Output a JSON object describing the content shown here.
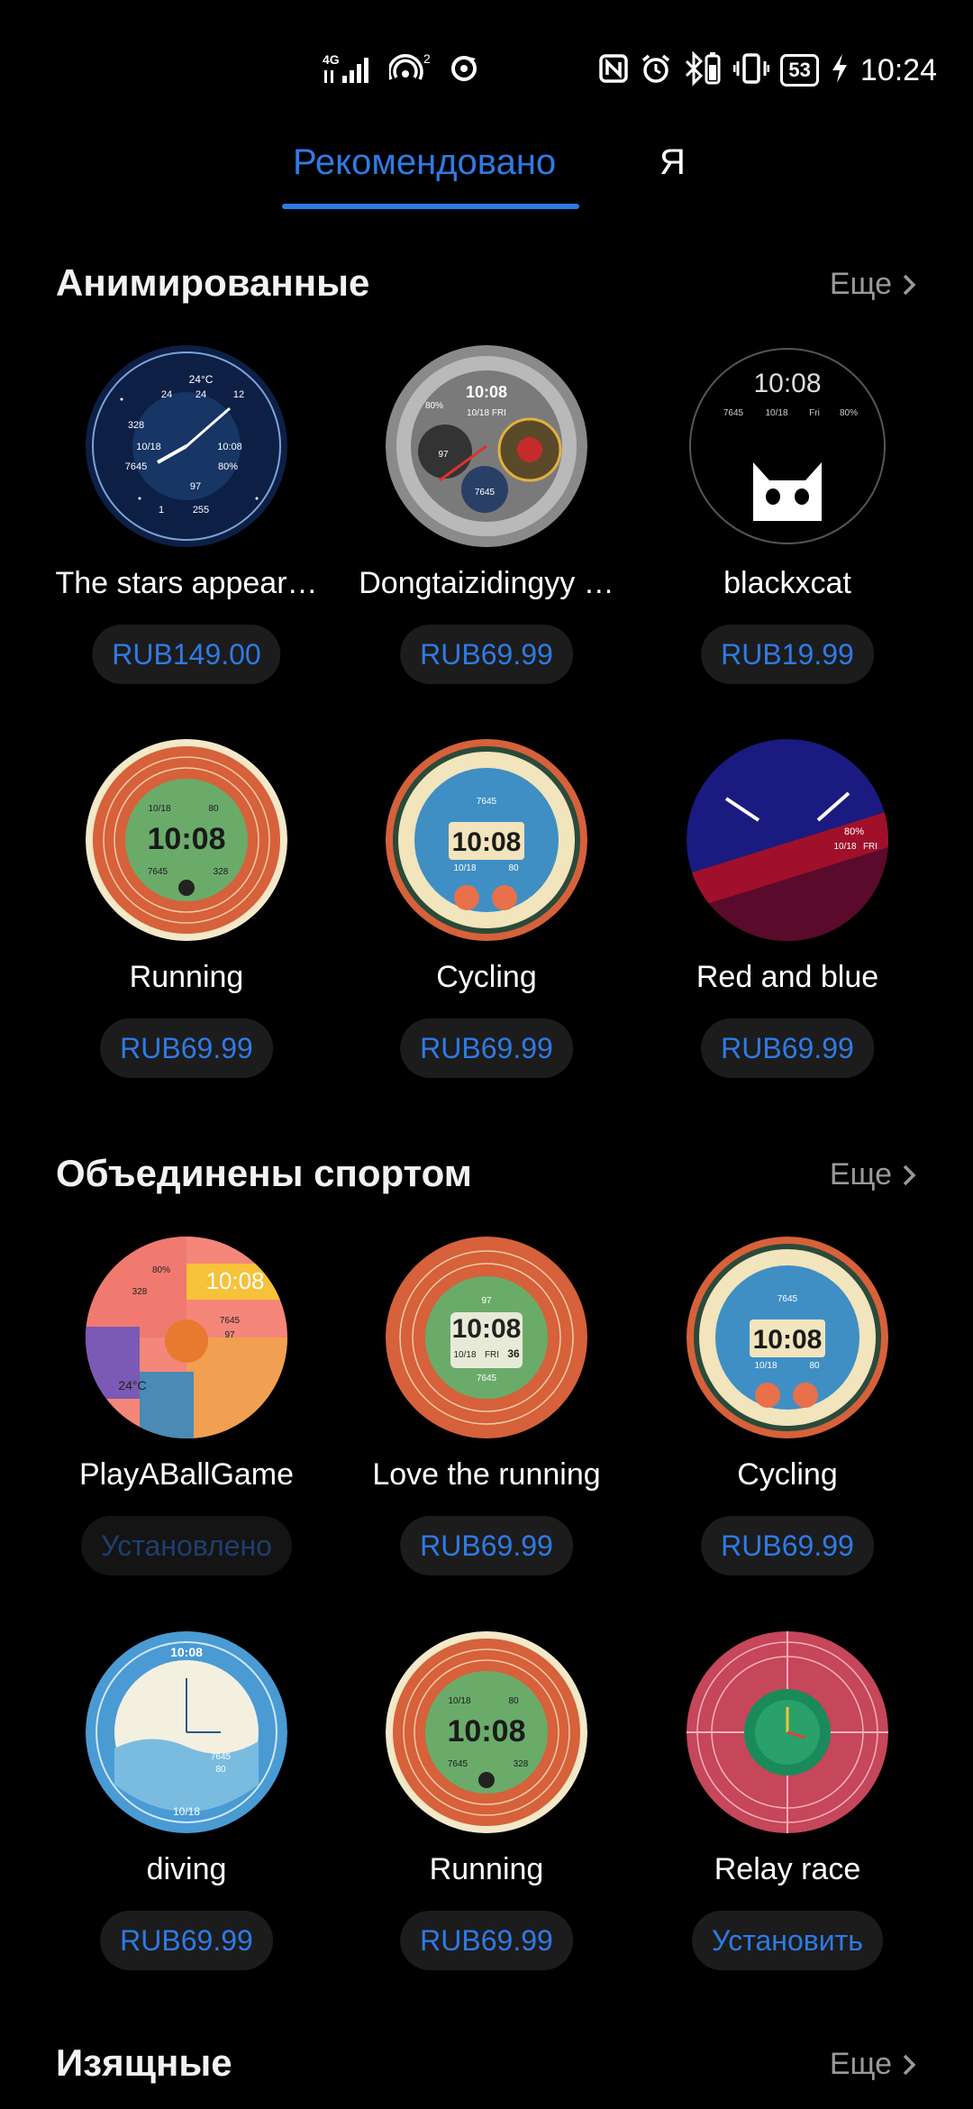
{
  "status_bar": {
    "network": "4G",
    "hotspot_count": "2",
    "battery": "53",
    "time": "10:24"
  },
  "tabs": [
    {
      "label": "Рекомендовано",
      "active": true
    },
    {
      "label": "Я",
      "active": false
    }
  ],
  "sections": [
    {
      "title": "Анимированные",
      "more": "Еще",
      "items": [
        {
          "name": "The stars appear…",
          "price": "RUB149.00",
          "face": {
            "type": "stars",
            "texts": [
              "24°C",
              "24",
              "24",
              "12",
              "328",
              "10/18",
              "10:08",
              "7645",
              "80%",
              "97",
              "1",
              "255"
            ]
          }
        },
        {
          "name": "Dongtaizidingyy …",
          "price": "RUB69.99",
          "face": {
            "type": "mech",
            "texts": [
              "10:08",
              "10/18 FRI",
              "80%",
              "97",
              "7645"
            ]
          }
        },
        {
          "name": "blackxcat",
          "price": "RUB19.99",
          "face": {
            "type": "cat",
            "texts": [
              "10:08",
              "7645",
              "10/18",
              "Fri",
              "80%"
            ]
          }
        },
        {
          "name": "Running",
          "price": "RUB69.99",
          "face": {
            "type": "run",
            "texts": [
              "10:08",
              "10/18",
              "80",
              "7645",
              "328"
            ]
          }
        },
        {
          "name": "Cycling",
          "price": "RUB69.99",
          "face": {
            "type": "cycle",
            "texts": [
              "10:08",
              "7645",
              "10/18",
              "80"
            ]
          }
        },
        {
          "name": "Red and blue",
          "price": "RUB69.99",
          "face": {
            "type": "redblue",
            "texts": [
              "80%",
              "10/18",
              "FRI"
            ]
          }
        }
      ]
    },
    {
      "title": "Объединены спортом",
      "more": "Еще",
      "items": [
        {
          "name": "PlayABallGame",
          "price": "Установлено",
          "installed": true,
          "face": {
            "type": "ball",
            "texts": [
              "10:08",
              "80%",
              "328",
              "7645",
              "97",
              "24°C"
            ]
          }
        },
        {
          "name": "Love the running",
          "price": "RUB69.99",
          "face": {
            "type": "love",
            "texts": [
              "10:08",
              "97",
              "10/18",
              "FRI",
              "36",
              "7645"
            ]
          }
        },
        {
          "name": "Cycling",
          "price": "RUB69.99",
          "face": {
            "type": "cycle",
            "texts": [
              "10:08",
              "7645",
              "10/18",
              "80"
            ]
          }
        },
        {
          "name": "diving",
          "price": "RUB69.99",
          "face": {
            "type": "diving",
            "texts": [
              "10:08",
              "7645",
              "80",
              "10/18"
            ]
          }
        },
        {
          "name": "Running",
          "price": "RUB69.99",
          "face": {
            "type": "run",
            "texts": [
              "10:08",
              "10/18",
              "80",
              "7645",
              "328"
            ]
          }
        },
        {
          "name": "Relay race",
          "price": "Установить",
          "face": {
            "type": "relay",
            "texts": []
          }
        }
      ]
    },
    {
      "title": "Изящные",
      "more": "Еще",
      "items": []
    }
  ],
  "colors": {
    "accent": "#2f7ae5",
    "background": "#000000",
    "chip": "#1c1c1c",
    "installed_text": "#1e3f6e"
  }
}
